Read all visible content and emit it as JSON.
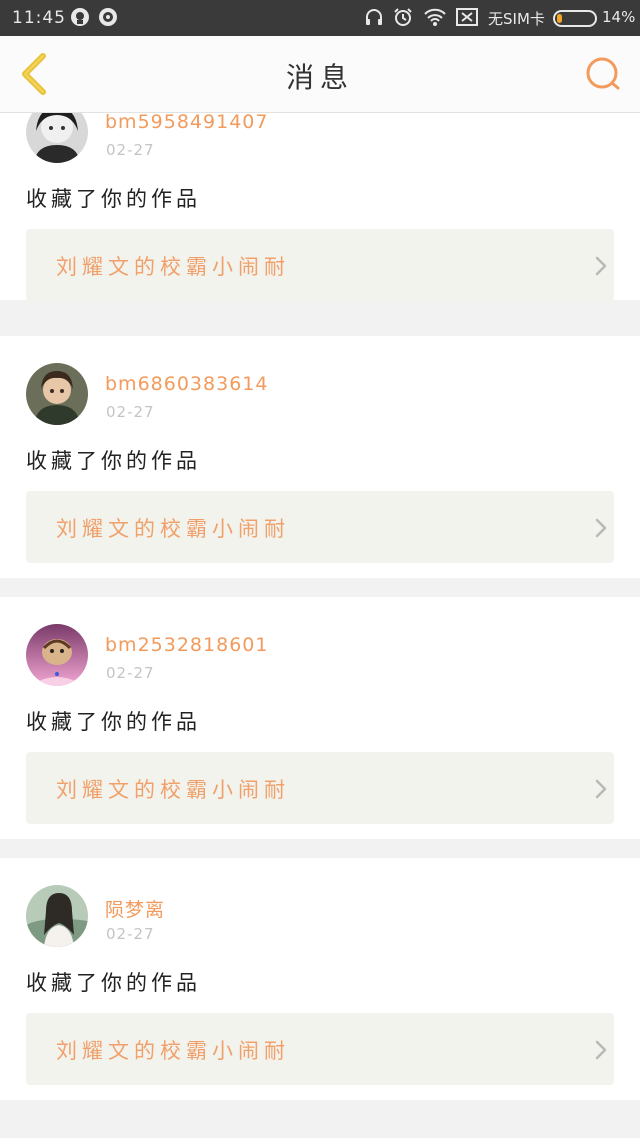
{
  "status_bar": {
    "time": "11:45",
    "sim": "无SIM卡",
    "battery_percent": "14%",
    "battery_level": 0.14,
    "icons": [
      "app-icon-1",
      "app-icon-2",
      "headphone-icon",
      "alarm-icon",
      "wifi-icon",
      "no-sim-icon",
      "battery-icon"
    ]
  },
  "navbar": {
    "back_icon": "chevron-left-icon",
    "title": "消息",
    "search_icon": "search-icon"
  },
  "colors": {
    "accent": "#f29b5c",
    "back_icon": "#e8c23a",
    "card_bg": "#ffffff",
    "work_bg": "#f3f3ee",
    "divider_bg": "#f2f2f2"
  },
  "messages": [
    {
      "username": "bm5958491407",
      "date": "02-27",
      "action": "收藏了你的作品",
      "work_title": "刘耀文的校霸小闹耐",
      "avatar": "avatar-bw-portrait"
    },
    {
      "username": "bm6860383614",
      "date": "02-27",
      "action": "收藏了你的作品",
      "work_title": "刘耀文的校霸小闹耐",
      "avatar": "avatar-child-portrait"
    },
    {
      "username": "bm2532818601",
      "date": "02-27",
      "action": "收藏了你的作品",
      "work_title": "刘耀文的校霸小闹耐",
      "avatar": "avatar-tiger-pink"
    },
    {
      "username": "陨梦离",
      "date": "02-27",
      "action": "收藏了你的作品",
      "work_title": "刘耀文的校霸小闹耐",
      "avatar": "avatar-girl-nature"
    }
  ]
}
